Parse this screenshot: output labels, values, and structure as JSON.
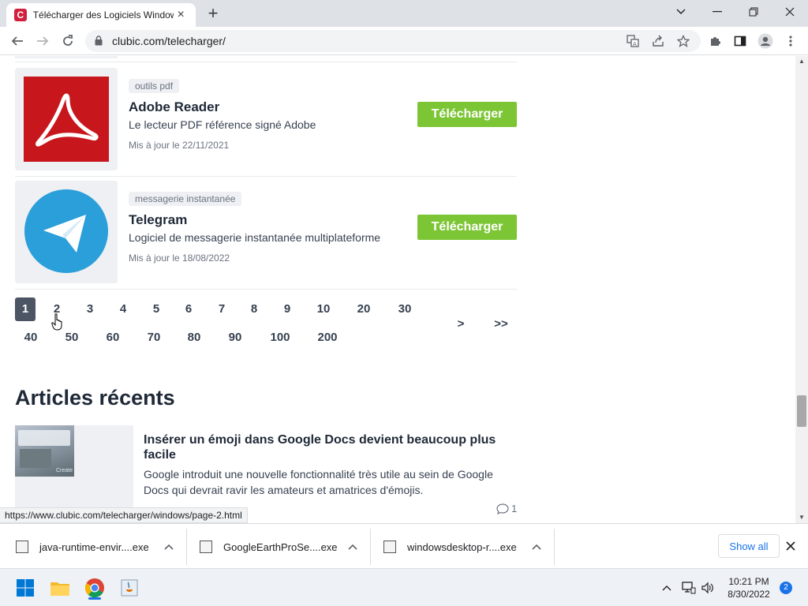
{
  "browser": {
    "tab_title": "Télécharger des Logiciels Windows",
    "favicon_letter": "C",
    "url": "clubic.com/telecharger/",
    "brand_color": "#d11f3d"
  },
  "page": {
    "items": [
      {
        "tag": "outils pdf",
        "name": "Adobe Reader",
        "description": "Le lecteur PDF référence signé Adobe",
        "updated": "Mis à jour le 22/11/2021",
        "button": "Télécharger"
      },
      {
        "tag": "messagerie instantanée",
        "name": "Telegram",
        "description": "Logiciel de messagerie instantanée multiplateforme",
        "updated": "Mis à jour le 18/08/2022",
        "button": "Télécharger"
      }
    ],
    "pagination": {
      "row1": [
        "1",
        "2",
        "3",
        "4",
        "5",
        "6",
        "7",
        "8",
        "9",
        "10",
        "20",
        "30"
      ],
      "row2": [
        "40",
        "50",
        "60",
        "70",
        "80",
        "90",
        "100",
        "200"
      ],
      "next": ">",
      "last": ">>",
      "active": "1"
    },
    "articles_title": "Articles récents",
    "article": {
      "title": "Insérer un émoji dans Google Docs devient beaucoup plus facile",
      "excerpt": "Google introduit une nouvelle fonctionnalité très utile au sein de Google Docs qui devrait ravir les amateurs et amatrices d'émojis.",
      "comments": "1",
      "image_caption": "Create"
    },
    "status_url": "https://www.clubic.com/telecharger/windows/page-2.html",
    "download_button_color": "#7cc535"
  },
  "downloads": {
    "items": [
      "java-runtime-envir....exe",
      "GoogleEarthProSe....exe",
      "windowsdesktop-r....exe"
    ],
    "show_all": "Show all"
  },
  "taskbar": {
    "time": "10:21 PM",
    "date": "8/30/2022",
    "notifications": "2"
  }
}
